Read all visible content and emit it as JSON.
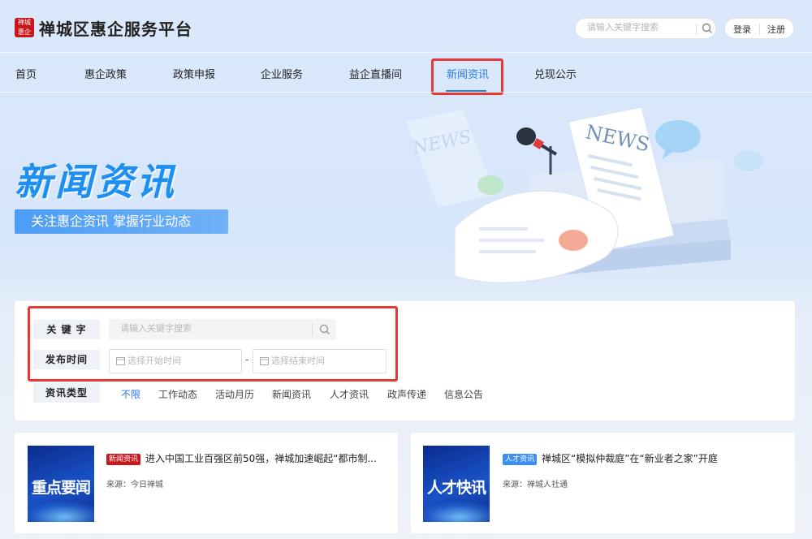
{
  "header": {
    "logo_text": [
      "禅城",
      "惠企"
    ],
    "title": "禅城区惠企服务平台",
    "search_placeholder": "请输入关键字搜索",
    "login": "登录",
    "register": "注册"
  },
  "nav": {
    "items": [
      "首页",
      "惠企政策",
      "政策申报",
      "企业服务",
      "益企直播间",
      "新闻资讯",
      "兑现公示"
    ],
    "active_index": 5
  },
  "banner": {
    "title": "新闻资讯",
    "subtitle": "关注惠企资讯 掌握行业动态",
    "art_text": "NEWS"
  },
  "filter": {
    "keyword_label": "关 键 字",
    "keyword_placeholder": "请输入关键字搜索",
    "date_label": "发布时间",
    "date_start_placeholder": "选择开始时间",
    "date_separator": "-",
    "date_end_placeholder": "选择结束时间",
    "type_label": "资讯类型",
    "types": [
      "不限",
      "工作动态",
      "活动月历",
      "新闻资讯",
      "人才资讯",
      "政声传递",
      "信息公告"
    ],
    "active_type_index": 0
  },
  "news": [
    {
      "thumb_title": "重点要闻",
      "tag": "新闻资讯",
      "tag_color": "#c8161d",
      "title": "进入中国工业百强区前50强，禅城加速崛起“都市制...",
      "source": "来源：今日禅城"
    },
    {
      "thumb_title": "人才快讯",
      "tag": "人才资讯",
      "tag_color": "#3c8ef3",
      "title": "禅城区“模拟仲裁庭”在“新业者之家”开庭",
      "source": "来源：禅城人社通"
    }
  ],
  "colors": {
    "accent": "#2b7be4",
    "highlight": "#e53935",
    "banner_title": "#1d8ff0"
  }
}
